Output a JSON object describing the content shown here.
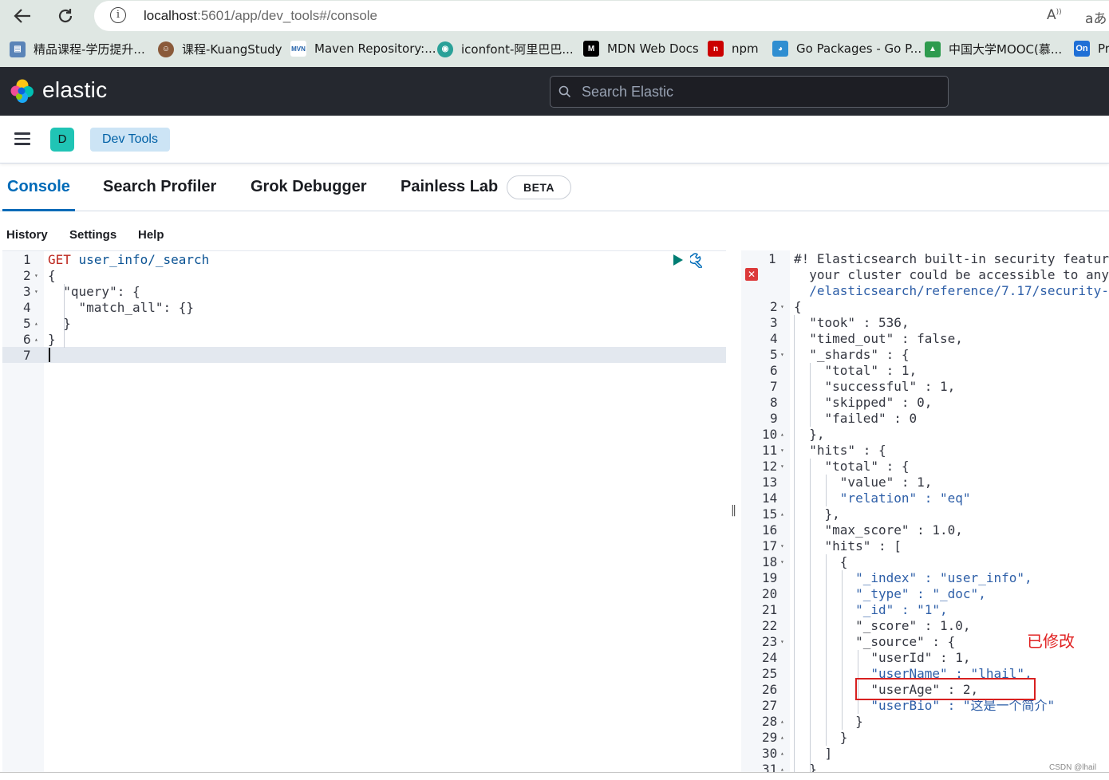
{
  "browser": {
    "url_host": "localhost",
    "url_path": ":5601/app/dev_tools#/console",
    "read_aloud_label": "A",
    "translate_label": "aあ",
    "bookmarks": [
      {
        "label": "精品课程-学历提升...",
        "icon": "page-icon",
        "color": "#5a84b8"
      },
      {
        "label": "课程-KuangStudy",
        "icon": "avatar-icon",
        "color": "#8a5a3a"
      },
      {
        "label": "Maven Repository:...",
        "icon": "maven-icon",
        "color": "#1f5fa8"
      },
      {
        "label": "iconfont-阿里巴巴...",
        "icon": "iconfont-icon",
        "color": "#2aa198"
      },
      {
        "label": "MDN Web Docs",
        "icon": "mdn-icon",
        "color": "#000000"
      },
      {
        "label": "npm",
        "icon": "npm-icon",
        "color": "#cb0000"
      },
      {
        "label": "Go Packages - Go P...",
        "icon": "gopher-icon",
        "color": "#2f8ed1"
      },
      {
        "label": "中国大学MOOC(慕...",
        "icon": "mooc-icon",
        "color": "#2e9b4e"
      },
      {
        "label": "Pr",
        "icon": "on-icon",
        "color": "#1f6fd6",
        "badge": "On"
      }
    ]
  },
  "header": {
    "brand": "elastic",
    "search_placeholder": "Search Elastic"
  },
  "breadcrumb": {
    "space_initial": "D",
    "current": "Dev Tools"
  },
  "tabs": [
    {
      "label": "Console",
      "active": true
    },
    {
      "label": "Search Profiler",
      "active": false
    },
    {
      "label": "Grok Debugger",
      "active": false
    },
    {
      "label": "Painless Lab",
      "active": false
    }
  ],
  "beta_badge": "BETA",
  "submenu": [
    "History",
    "Settings",
    "Help"
  ],
  "request": {
    "line_numbers": [
      "1",
      "2",
      "3",
      "4",
      "5",
      "6",
      "7"
    ],
    "method": "GET",
    "path": "user_info/_search",
    "body_lines": [
      "{",
      "  \"query\": {",
      "    \"match_all\": {}",
      "  }",
      "}"
    ]
  },
  "response": {
    "warning_line_1": "#! Elasticsearch built-in security featur",
    "warning_line_2": "  your cluster could be accessible to any",
    "warning_line_3": "  /elasticsearch/reference/7.17/security-",
    "line_numbers": [
      "1",
      "2",
      "3",
      "4",
      "5",
      "6",
      "7",
      "8",
      "9",
      "10",
      "11",
      "12",
      "13",
      "14",
      "15",
      "16",
      "17",
      "18",
      "19",
      "20",
      "21",
      "22",
      "23",
      "24",
      "25",
      "26",
      "27",
      "28",
      "29",
      "30",
      "31"
    ],
    "lines": [
      "{",
      "  \"took\" : 536,",
      "  \"timed_out\" : false,",
      "  \"_shards\" : {",
      "    \"total\" : 1,",
      "    \"successful\" : 1,",
      "    \"skipped\" : 0,",
      "    \"failed\" : 0",
      "  },",
      "  \"hits\" : {",
      "    \"total\" : {",
      "      \"value\" : 1,",
      "      \"relation\" : \"eq\"",
      "    },",
      "    \"max_score\" : 1.0,",
      "    \"hits\" : [",
      "      {",
      "        \"_index\" : \"user_info\",",
      "        \"_type\" : \"_doc\",",
      "        \"_id\" : \"1\",",
      "        \"_score\" : 1.0,",
      "        \"_source\" : {",
      "          \"userId\" : 1,",
      "          \"userName\" : \"lhail\",",
      "          \"userAge\" : 2,",
      "          \"userBio\" : \"这是一个简介\"",
      "        }",
      "      }",
      "    ]",
      "  }"
    ]
  },
  "annotation": "已修改",
  "watermark": "CSDN @lhail"
}
